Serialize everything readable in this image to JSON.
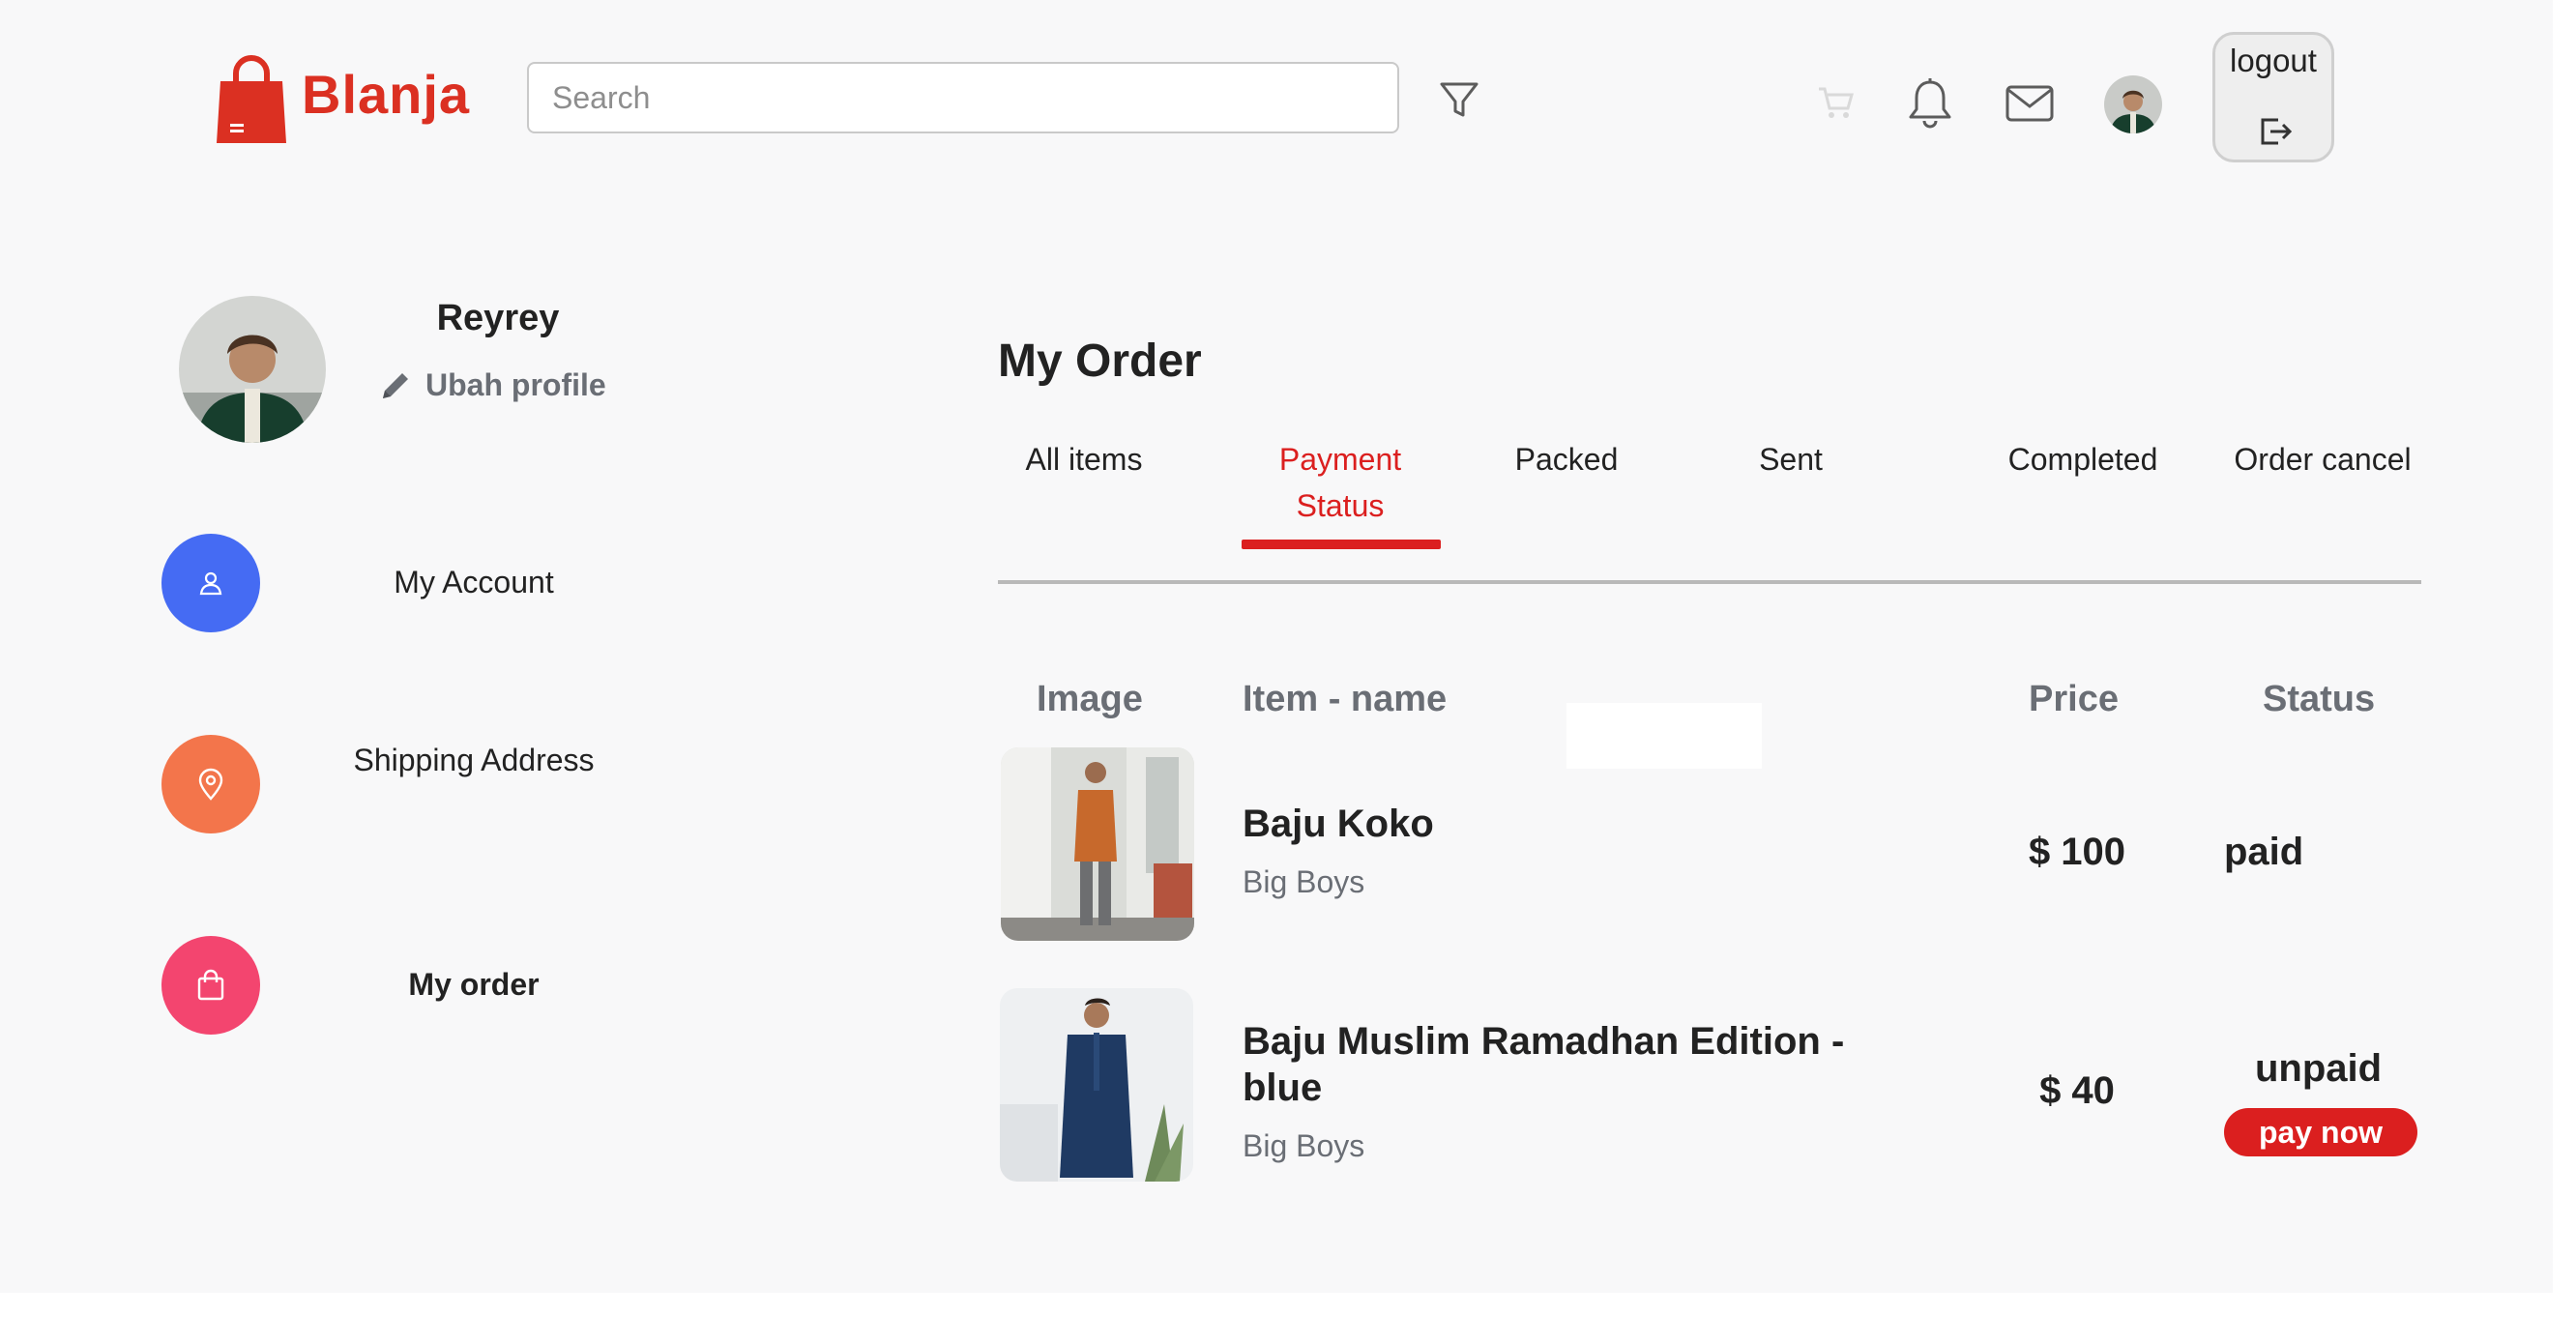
{
  "header": {
    "brand": "Blanja",
    "search": {
      "placeholder": "Search",
      "value": ""
    },
    "icons": [
      "shopping-bag-icon",
      "filter-icon",
      "cart-icon",
      "bell-icon",
      "mail-icon",
      "logout-icon"
    ],
    "logout_label": "logout"
  },
  "profile": {
    "name": "Reyrey",
    "edit_label": "Ubah profile"
  },
  "sidebar": {
    "items": [
      {
        "label": "My Account",
        "icon": "user-icon",
        "color": "#456bf3"
      },
      {
        "label": "Shipping Address",
        "icon": "map-pin-icon",
        "color": "#f3754b"
      },
      {
        "label": "My order",
        "icon": "shopping-bag-icon",
        "color": "#f3456f",
        "active": true
      }
    ]
  },
  "main": {
    "title": "My Order",
    "tabs": [
      {
        "label": "All items"
      },
      {
        "label": "Payment Status",
        "active": true
      },
      {
        "label": "Packed"
      },
      {
        "label": "Sent"
      },
      {
        "label": "Completed"
      },
      {
        "label": "Order cancel"
      }
    ],
    "columns": {
      "image": "Image",
      "item": "Item - name",
      "price": "Price",
      "status": "Status"
    },
    "orders": [
      {
        "name": "Baju Koko",
        "brand": "Big Boys",
        "price": "$ 100",
        "status": "paid"
      },
      {
        "name": "Baju Muslim Ramadhan Edition - blue",
        "brand": "Big Boys",
        "price": "$ 40",
        "status": "unpaid",
        "action": "pay now"
      }
    ]
  },
  "colors": {
    "accent": "#db3022",
    "tab_active": "#db1f1f",
    "muted_text": "#6a6e75",
    "background": "#f8f8f9"
  }
}
